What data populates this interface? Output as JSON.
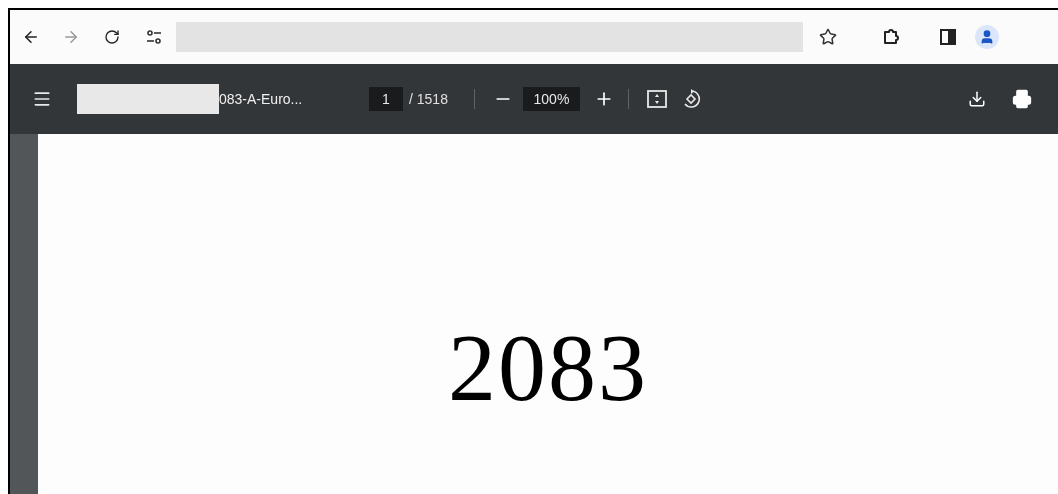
{
  "pdf_toolbar": {
    "title": "083-A-Euro...",
    "page_input": "1",
    "page_total": "/ 1518",
    "zoom": "100%"
  },
  "document": {
    "heading": "2083"
  }
}
